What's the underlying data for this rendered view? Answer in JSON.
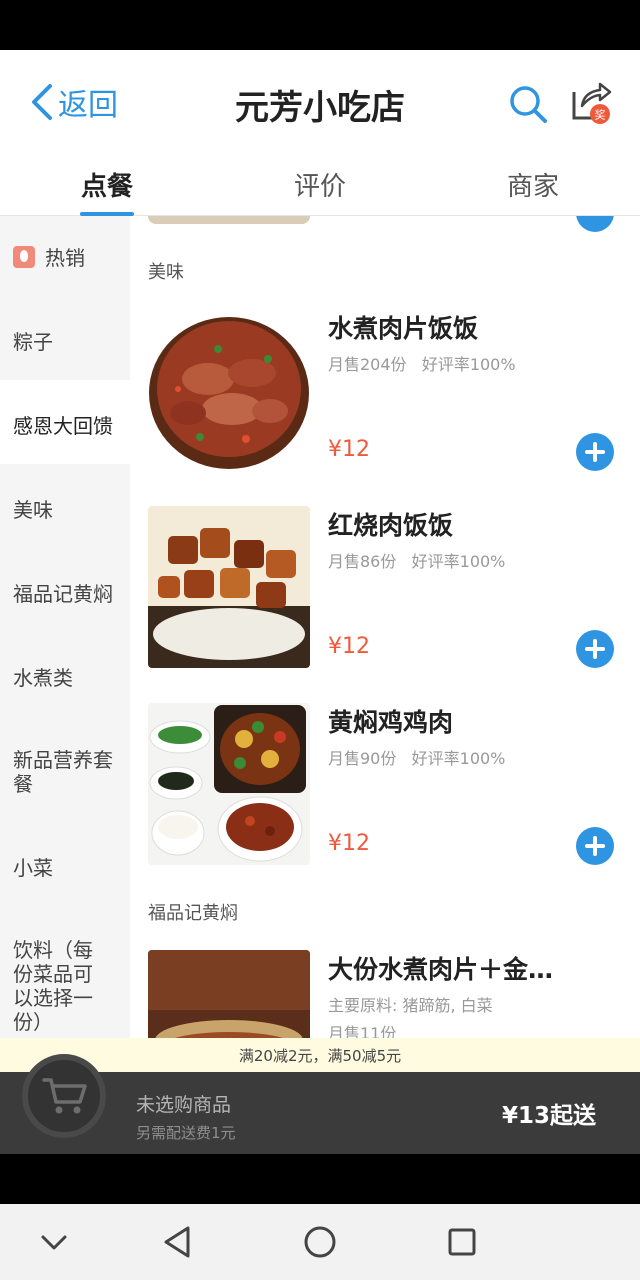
{
  "header": {
    "back_label": "返回",
    "title": "元芳小吃店"
  },
  "tabs": [
    {
      "label": "点餐"
    },
    {
      "label": "评价"
    },
    {
      "label": "商家"
    }
  ],
  "sidebar": {
    "items": [
      {
        "label": "热销"
      },
      {
        "label": "粽子"
      },
      {
        "label": "感恩大回馈"
      },
      {
        "label": "美味"
      },
      {
        "label": "福品记黄焖"
      },
      {
        "label": "水煮类"
      },
      {
        "label": "新品营养套餐"
      },
      {
        "label": "小菜"
      },
      {
        "label": "饮料（每份菜品可以选择一份）"
      }
    ]
  },
  "sections": {
    "s1": "美味",
    "s2": "福品记黄焖"
  },
  "foods": [
    {
      "name": "水煮肉片饭饭",
      "sales": "月售204份",
      "rating": "好评率100%",
      "price": "¥12"
    },
    {
      "name": "红烧肉饭饭",
      "sales": "月售86份",
      "rating": "好评率100%",
      "price": "¥12"
    },
    {
      "name": "黄焖鸡鸡肉",
      "sales": "月售90份",
      "rating": "好评率100%",
      "price": "¥12"
    },
    {
      "name": "大份水煮肉片＋金…",
      "ingredients": "主要原料: 猪蹄筋, 白菜",
      "sales": "月售11份"
    }
  ],
  "promo": "满20减2元，满50减5元",
  "cart": {
    "label": "未选购商品",
    "fee": "另需配送费1元",
    "min_order": "¥13起送"
  },
  "colors": {
    "accent": "#2f95e2",
    "price": "#f05a3c",
    "cart_bar": "#3b3b3b",
    "promo_bg": "#fffbe0"
  }
}
